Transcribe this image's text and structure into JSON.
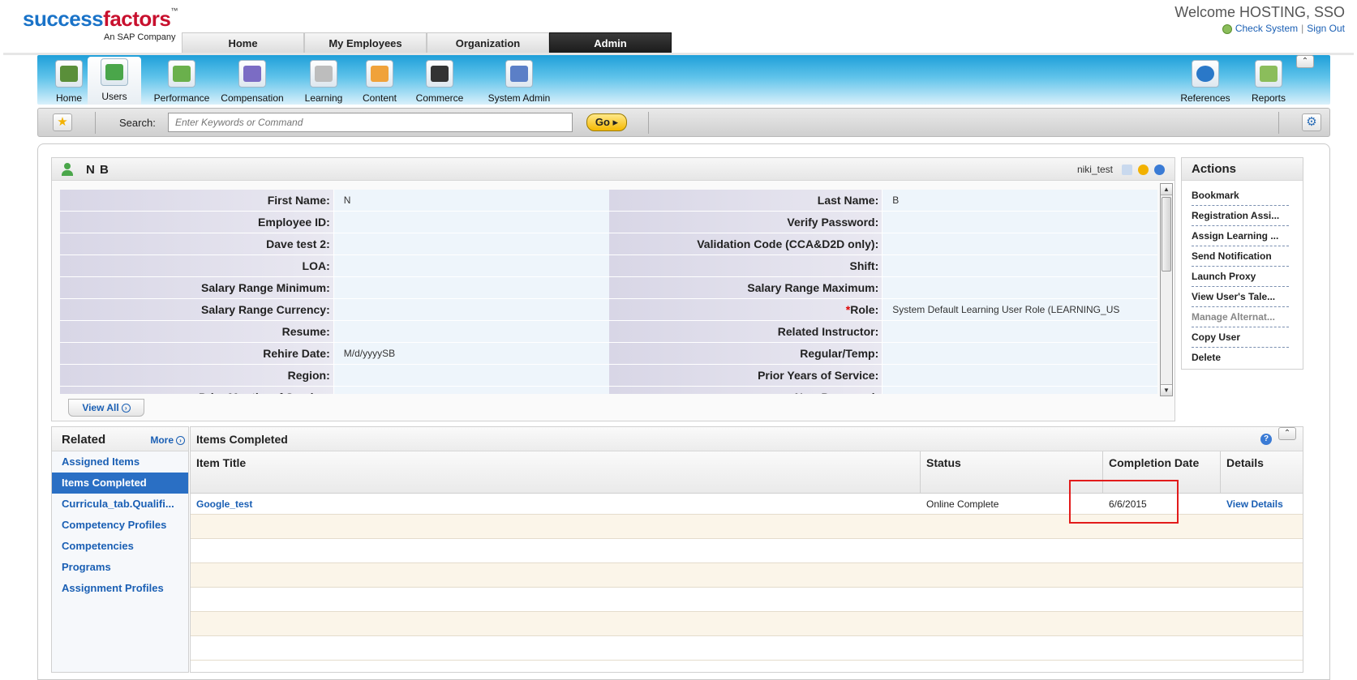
{
  "header": {
    "brand_main": "success",
    "brand_accent": "factors",
    "brand_tm": "™",
    "brand_sub": "An SAP Company",
    "welcome": "Welcome HOSTING, SSO",
    "check_system": "Check System",
    "sign_out": "Sign Out"
  },
  "nav": {
    "tabs": [
      {
        "label": "Home"
      },
      {
        "label": "My Employees"
      },
      {
        "label": "Organization"
      },
      {
        "label": "Admin",
        "active": true
      }
    ]
  },
  "modules": {
    "left": [
      {
        "label": "Home",
        "icon": "home-icon",
        "color": "#5a8f3a"
      },
      {
        "label": "Users",
        "icon": "users-icon",
        "color": "#4aa64a",
        "active": true
      },
      {
        "label": "Performance",
        "icon": "performance-chart-icon",
        "color": "#6ab04c"
      },
      {
        "label": "Compensation",
        "icon": "compensation-icon",
        "color": "#7b6cc4"
      },
      {
        "label": "Learning",
        "icon": "learning-document-icon",
        "color": "#bdbdbd"
      },
      {
        "label": "Content",
        "icon": "content-folder-icon",
        "color": "#f0a23a"
      },
      {
        "label": "Commerce",
        "icon": "commerce-briefcase-icon",
        "color": "#333333"
      },
      {
        "label": "System Admin",
        "icon": "system-admin-icon",
        "color": "#5b7fc7"
      }
    ],
    "right": [
      {
        "label": "References",
        "icon": "info-icon",
        "color": "#2a78c8"
      },
      {
        "label": "Reports",
        "icon": "reports-chart-icon",
        "color": "#8bbd5b"
      }
    ],
    "collapse_glyph": "⌃"
  },
  "search": {
    "label": "Search:",
    "placeholder": "Enter Keywords or Command",
    "go_label": "Go ▸",
    "star_glyph": "★",
    "gear_glyph": "⚙"
  },
  "user": {
    "name": "N B",
    "userid": "niki_test",
    "fields": [
      {
        "l1": "First Name:",
        "v1": "N",
        "l2": "Last Name:",
        "v2": "B"
      },
      {
        "l1": "Employee ID:",
        "v1": "",
        "l2": "Verify Password:",
        "v2": ""
      },
      {
        "l1": "Dave test 2:",
        "v1": "",
        "l2": "Validation Code (CCA&D2D only):",
        "v2": ""
      },
      {
        "l1": "LOA:",
        "v1": "",
        "l2": "Shift:",
        "v2": ""
      },
      {
        "l1": "Salary Range Minimum:",
        "v1": "",
        "l2": "Salary Range Maximum:",
        "v2": ""
      },
      {
        "l1": "Salary Range Currency:",
        "v1": "",
        "l2": "Role:",
        "v2": "System Default Learning User Role (LEARNING_US",
        "req2": "*"
      },
      {
        "l1": "Resume:",
        "v1": "",
        "l2": "Related Instructor:",
        "v2": ""
      },
      {
        "l1": "Rehire Date:",
        "v1": "M/d/yyyySB",
        "l2": "Regular/Temp:",
        "v2": ""
      },
      {
        "l1": "Region:",
        "v1": "",
        "l2": "Prior Years of Service:",
        "v2": ""
      },
      {
        "l1": "Prior Months of Service:",
        "v1": "",
        "l2": "New Password:",
        "v2": ""
      }
    ],
    "view_all": "View All"
  },
  "actions": {
    "title": "Actions",
    "items": [
      {
        "label": "Bookmark"
      },
      {
        "label": "Registration Assi..."
      },
      {
        "label": "Assign Learning ..."
      },
      {
        "label": "Send Notification"
      },
      {
        "label": "Launch Proxy"
      },
      {
        "label": "View User's Tale..."
      },
      {
        "label": "Manage Alternat...",
        "disabled": true
      },
      {
        "label": "Copy User"
      },
      {
        "label": "Delete"
      }
    ]
  },
  "related": {
    "title": "Related",
    "more": "More",
    "items": [
      {
        "label": "Assigned Items"
      },
      {
        "label": "Items Completed",
        "active": true
      },
      {
        "label": "Curricula_tab.Qualifi..."
      },
      {
        "label": "Competency Profiles"
      },
      {
        "label": "Competencies"
      },
      {
        "label": "Programs"
      },
      {
        "label": "Assignment Profiles"
      }
    ]
  },
  "items_completed": {
    "title": "Items Completed",
    "columns": [
      "Item Title",
      "Status",
      "Completion Date",
      "Details"
    ],
    "rows": [
      {
        "title": "Google_test",
        "status": "Online Complete",
        "date": "6/6/2015",
        "details": "View Details"
      }
    ],
    "help_glyph": "?"
  },
  "colors": {
    "accent_blue": "#1a5fb4",
    "admin_tab": "#1a1a1a",
    "highlight_box": "#e21b1b",
    "selected_item": "#2a6fc4"
  }
}
